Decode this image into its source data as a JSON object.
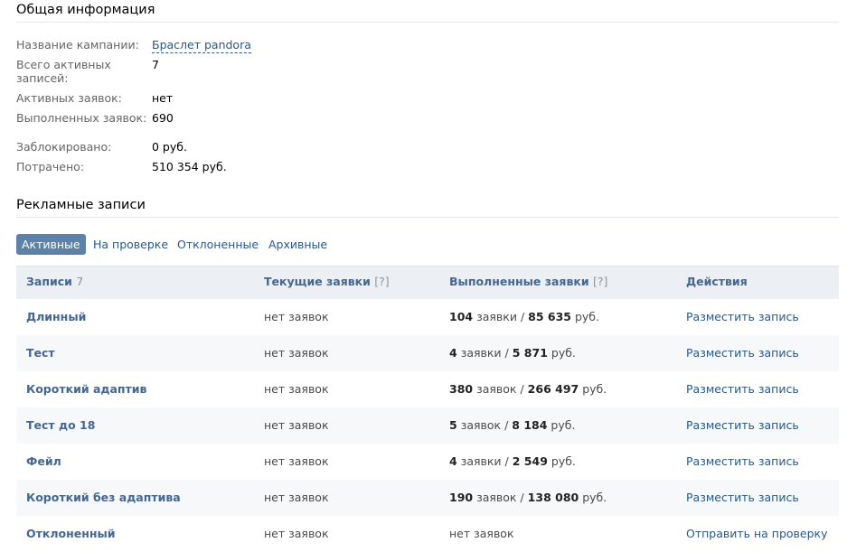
{
  "general": {
    "title": "Общая информация",
    "rows": [
      {
        "label": "Название кампании:",
        "value": "Браслет pandora",
        "link": true
      },
      {
        "label": "Всего активных записей:",
        "value": "7"
      },
      {
        "label": "Активных заявок:",
        "value": "нет"
      },
      {
        "label": "Выполненных заявок:",
        "value": "690"
      },
      {
        "label": "Заблокировано:",
        "value": "0 руб."
      },
      {
        "label": "Потрачено:",
        "value": "510 354 руб."
      }
    ]
  },
  "ads": {
    "title": "Рекламные записи",
    "tabs": [
      {
        "label": "Активные",
        "active": true
      },
      {
        "label": "На проверке",
        "active": false
      },
      {
        "label": "Отклоненные",
        "active": false
      },
      {
        "label": "Архивные",
        "active": false
      }
    ],
    "table": {
      "headers": {
        "posts": "Записи",
        "posts_count": "7",
        "current": "Текущие заявки",
        "current_help": "[?]",
        "done": "Выполненные заявки",
        "done_help": "[?]",
        "actions": "Действия"
      },
      "rows": [
        {
          "name": "Длинный",
          "current": "нет заявок",
          "done_count": "104",
          "done_count_unit": "заявки",
          "sep": "/",
          "done_sum": "85 635",
          "done_sum_unit": "руб.",
          "action": "Разместить запись"
        },
        {
          "name": "Тест",
          "current": "нет заявок",
          "done_count": "4",
          "done_count_unit": "заявки",
          "sep": "/",
          "done_sum": "5 871",
          "done_sum_unit": "руб.",
          "action": "Разместить запись"
        },
        {
          "name": "Короткий адаптив",
          "current": "нет заявок",
          "done_count": "380",
          "done_count_unit": "заявок",
          "sep": "/",
          "done_sum": "266 497",
          "done_sum_unit": "руб.",
          "action": "Разместить запись"
        },
        {
          "name": "Тест до 18",
          "current": "нет заявок",
          "done_count": "5",
          "done_count_unit": "заявок",
          "sep": "/",
          "done_sum": "8 184",
          "done_sum_unit": "руб.",
          "action": "Разместить запись"
        },
        {
          "name": "Фейл",
          "current": "нет заявок",
          "done_count": "4",
          "done_count_unit": "заявки",
          "sep": "/",
          "done_sum": "2 549",
          "done_sum_unit": "руб.",
          "action": "Разместить запись"
        },
        {
          "name": "Короткий без адаптива",
          "current": "нет заявок",
          "done_count": "190",
          "done_count_unit": "заявок",
          "sep": "/",
          "done_sum": "138 080",
          "done_sum_unit": "руб.",
          "action": "Разместить запись"
        },
        {
          "name": "Отклоненный",
          "current": "нет заявок",
          "done_text": "нет заявок",
          "action": "Отправить на проверку"
        }
      ]
    }
  }
}
